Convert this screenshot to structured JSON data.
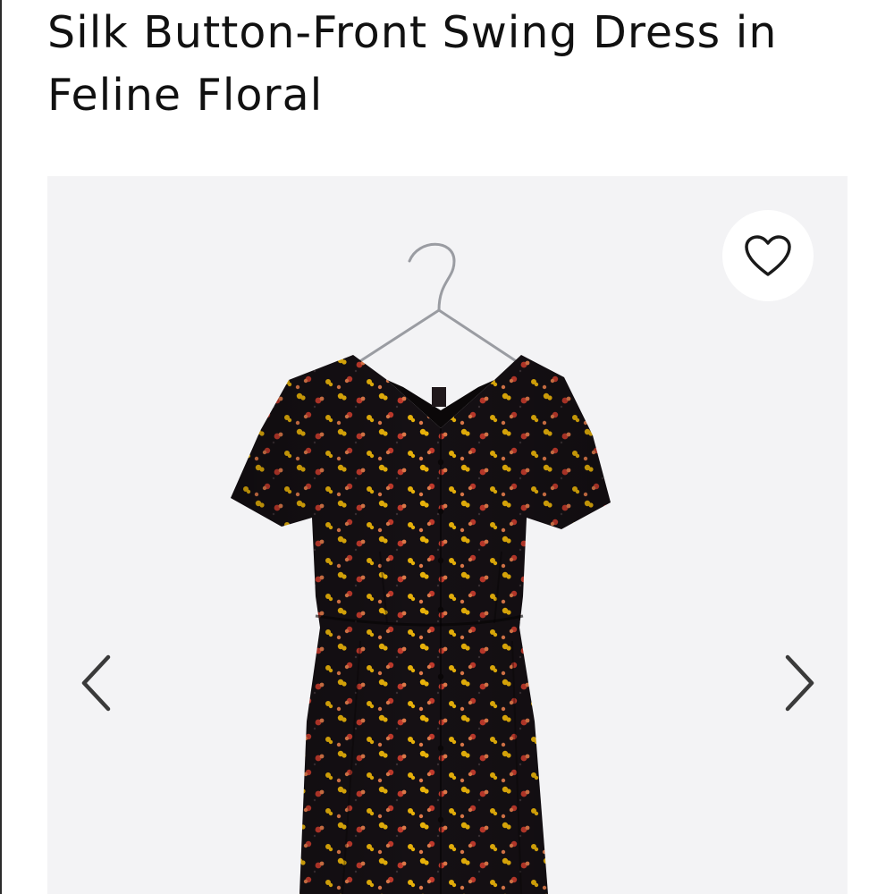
{
  "product": {
    "title": "Silk Button-Front Swing Dress in Feline Floral"
  },
  "gallery": {
    "background_color": "#f3f3f5",
    "dress_color": "#151014",
    "print_colors": [
      "#e8b20a",
      "#c23a2c",
      "#e07a4a"
    ],
    "icons": {
      "favorite": "heart-outline-icon",
      "previous": "chevron-left-icon",
      "next": "chevron-right-icon"
    }
  }
}
